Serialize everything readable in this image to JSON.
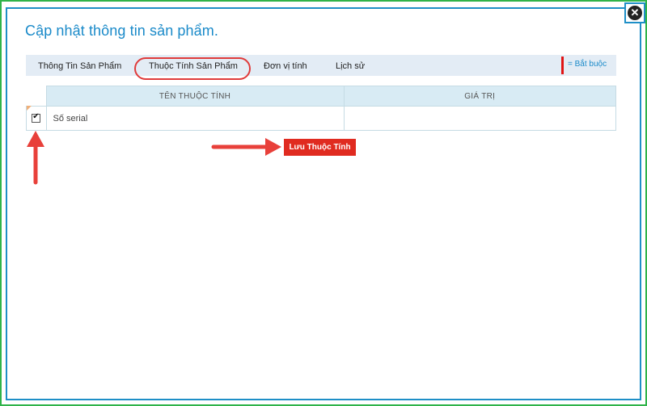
{
  "dialog": {
    "title": "Cập nhật thông tin sản phẩm.",
    "close_icon": "close-icon"
  },
  "tabs": [
    {
      "label": "Thông Tin Sản Phẩm",
      "active": false
    },
    {
      "label": "Thuộc Tính Sản Phẩm",
      "active": true
    },
    {
      "label": "Đơn vị tính",
      "active": false
    },
    {
      "label": "Lịch sử",
      "active": false
    }
  ],
  "required_legend": {
    "label": "= Bắt buộc",
    "color": "#e01414"
  },
  "table": {
    "columns": [
      "TÊN THUỘC TÍNH",
      "GIÁ TRỊ"
    ],
    "rows": [
      {
        "checked": true,
        "name": "Số serial",
        "value": ""
      }
    ]
  },
  "save_button": {
    "label": "Lưu Thuộc Tính"
  },
  "colors": {
    "accent": "#1a8ac9",
    "highlight": "#e03b3b",
    "button": "#e02b20",
    "frame_outer": "#2fb34a",
    "frame_inner": "#1e8fc7"
  }
}
